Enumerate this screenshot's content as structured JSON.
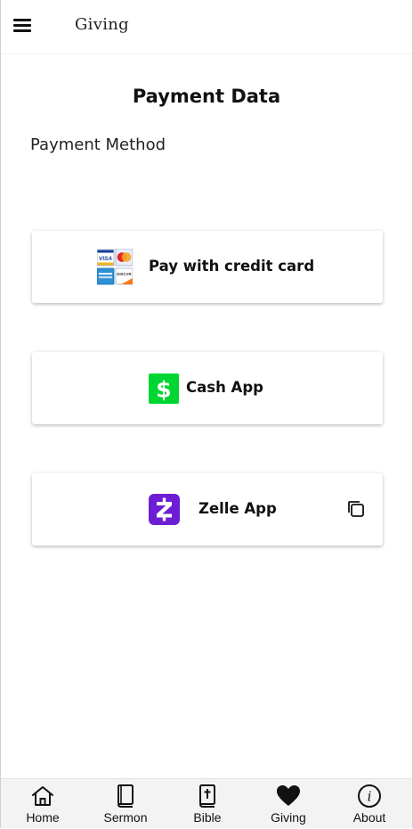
{
  "header": {
    "title": "Giving",
    "menu_icon": "hamburger-menu-icon"
  },
  "main": {
    "page_title": "Payment Data",
    "section_label": "Payment Method",
    "payment_options": [
      {
        "label": "Pay with credit card",
        "icon": "credit-card-logos-icon"
      },
      {
        "label": "Cash App",
        "icon": "cash-app-icon"
      },
      {
        "label": "Zelle App",
        "icon": "zelle-icon",
        "action_icon": "copy-icon"
      }
    ]
  },
  "colors": {
    "cash_app_green": "#00d632",
    "zelle_purple": "#6d1ed4"
  },
  "bottom_nav": {
    "items": [
      {
        "label": "Home",
        "icon": "home-icon"
      },
      {
        "label": "Sermon",
        "icon": "book-icon"
      },
      {
        "label": "Bible",
        "icon": "bible-icon"
      },
      {
        "label": "Giving",
        "icon": "heart-icon"
      },
      {
        "label": "About",
        "icon": "about-info-icon"
      }
    ]
  }
}
